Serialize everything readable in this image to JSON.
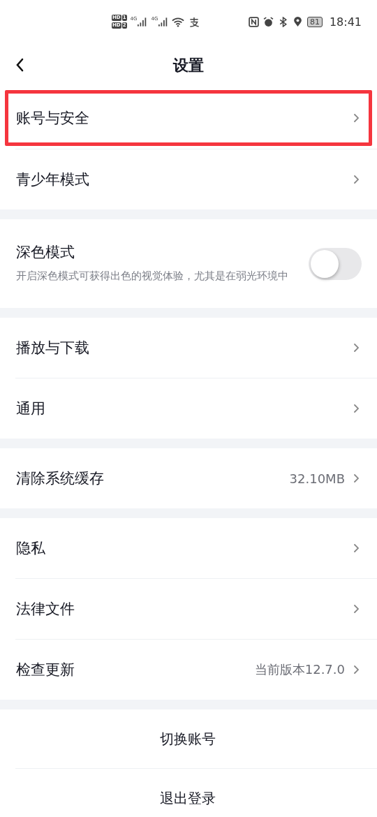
{
  "status_bar": {
    "sims": [
      {
        "badge": "HD",
        "slot": "1"
      },
      {
        "badge": "HD",
        "slot": "2"
      }
    ],
    "networks": [
      "4G",
      "4G"
    ],
    "battery": "81",
    "time": "18:41"
  },
  "header": {
    "title": "设置"
  },
  "groups": [
    {
      "items": [
        {
          "kind": "link",
          "label": "账号与安全",
          "highlighted": true
        },
        {
          "kind": "link",
          "label": "青少年模式",
          "highlighted": false
        }
      ]
    },
    {
      "items": [
        {
          "kind": "toggle",
          "label": "深色模式",
          "description": "开启深色模式可获得出色的视觉体验，尤其是在弱光环境中",
          "on": false
        }
      ]
    },
    {
      "items": [
        {
          "kind": "link",
          "label": "播放与下载",
          "highlighted": false
        },
        {
          "kind": "link",
          "label": "通用",
          "highlighted": false
        }
      ]
    },
    {
      "items": [
        {
          "kind": "link",
          "label": "清除系统缓存",
          "value": "32.10MB",
          "highlighted": false
        }
      ]
    },
    {
      "items": [
        {
          "kind": "link",
          "label": "隐私",
          "highlighted": false
        },
        {
          "kind": "link",
          "label": "法律文件",
          "highlighted": false
        },
        {
          "kind": "link",
          "label": "检查更新",
          "value": "当前版本12.7.0",
          "highlighted": false
        }
      ]
    },
    {
      "items": [
        {
          "kind": "action",
          "label": "切换账号"
        },
        {
          "kind": "action",
          "label": "退出登录"
        }
      ]
    }
  ]
}
